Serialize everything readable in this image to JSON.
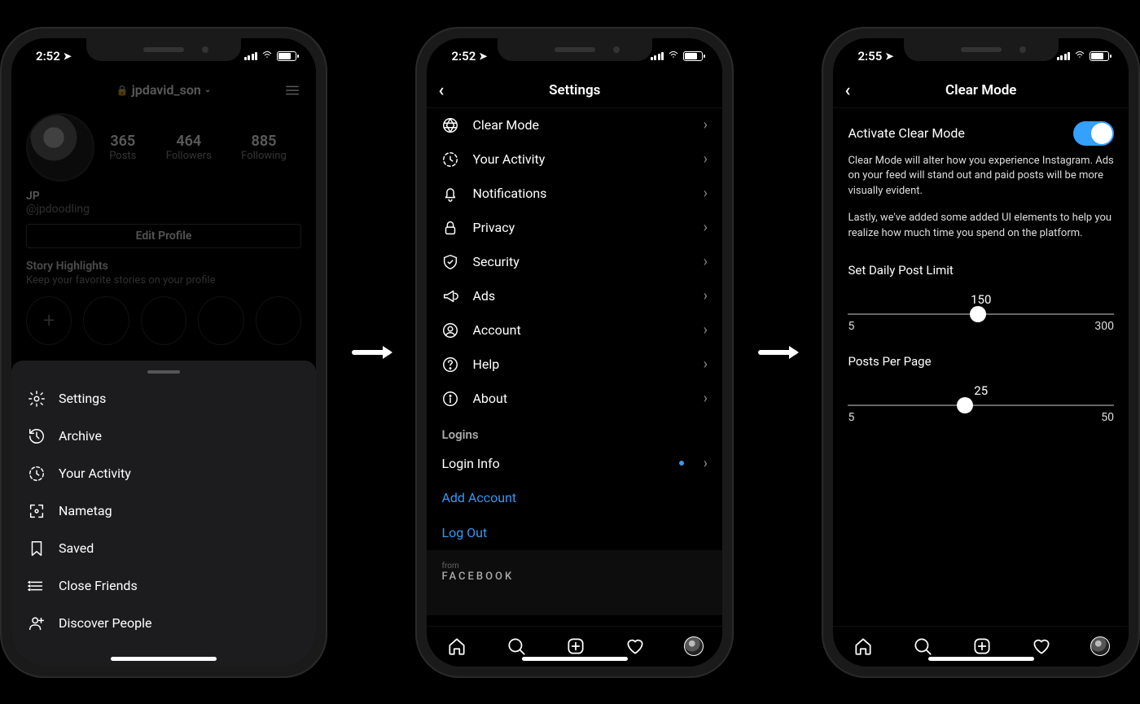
{
  "phone1": {
    "time": "2:52",
    "username": "jpdavid_son",
    "stats": {
      "posts": "365",
      "posts_label": "Posts",
      "followers": "464",
      "followers_label": "Followers",
      "following": "885",
      "following_label": "Following"
    },
    "bio_name": "JP",
    "bio_handle": "@jpdoodling",
    "edit_profile": "Edit Profile",
    "highlights_title": "Story Highlights",
    "highlights_sub": "Keep your favorite stories on your profile",
    "sheet": {
      "settings": "Settings",
      "archive": "Archive",
      "activity": "Your Activity",
      "nametag": "Nametag",
      "saved": "Saved",
      "close_friends": "Close Friends",
      "discover": "Discover People"
    }
  },
  "phone2": {
    "time": "2:52",
    "title": "Settings",
    "items": {
      "clear_mode": "Clear Mode",
      "activity": "Your Activity",
      "notifications": "Notifications",
      "privacy": "Privacy",
      "security": "Security",
      "ads": "Ads",
      "account": "Account",
      "help": "Help",
      "about": "About"
    },
    "logins_label": "Logins",
    "login_info": "Login Info",
    "add_account": "Add Account",
    "log_out": "Log Out",
    "from": "from",
    "facebook": "FACEBOOK"
  },
  "phone3": {
    "time": "2:55",
    "title": "Clear Mode",
    "activate_label": "Activate Clear Mode",
    "desc1": "Clear Mode will alter how you experience Instagram. Ads on your feed will stand out and paid posts will be more visually evident.",
    "desc2": "Lastly, we've added some added UI elements to help you realize how much time you spend on the platform.",
    "daily_label": "Set Daily Post Limit",
    "daily_value": "150",
    "daily_min": "5",
    "daily_max": "300",
    "ppp_label": "Posts Per Page",
    "ppp_value": "25",
    "ppp_min": "5",
    "ppp_max": "50"
  }
}
